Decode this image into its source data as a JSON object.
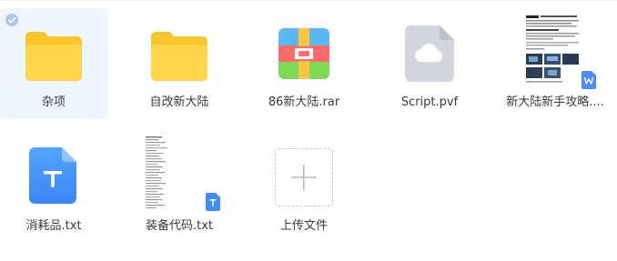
{
  "files": [
    {
      "name": "杂项",
      "type": "folder",
      "icon": "folder-icon",
      "selected": true
    },
    {
      "name": "自改新大陆",
      "type": "folder",
      "icon": "folder-icon",
      "selected": false
    },
    {
      "name": "86新大陆.rar",
      "type": "archive",
      "icon": "rar-archive-icon",
      "selected": false
    },
    {
      "name": "Script.pvf",
      "type": "unknown",
      "icon": "cloud-file-icon",
      "selected": false
    },
    {
      "name": "新大陆新手攻略....",
      "type": "word-document",
      "icon": "word-document-thumbnail",
      "selected": false
    },
    {
      "name": "消耗品.txt",
      "type": "text",
      "icon": "text-file-icon",
      "selected": false
    },
    {
      "name": "装备代码.txt",
      "type": "text",
      "icon": "text-document-thumbnail",
      "selected": false
    }
  ],
  "upload": {
    "label": "上传文件",
    "icon": "plus-icon"
  },
  "colors": {
    "folder": "#ffd54a",
    "selection_bg": "#f0f6ff",
    "check": "#a8c8f2",
    "txt_blue": "#3f8cff",
    "word_blue": "#4b8df8"
  }
}
